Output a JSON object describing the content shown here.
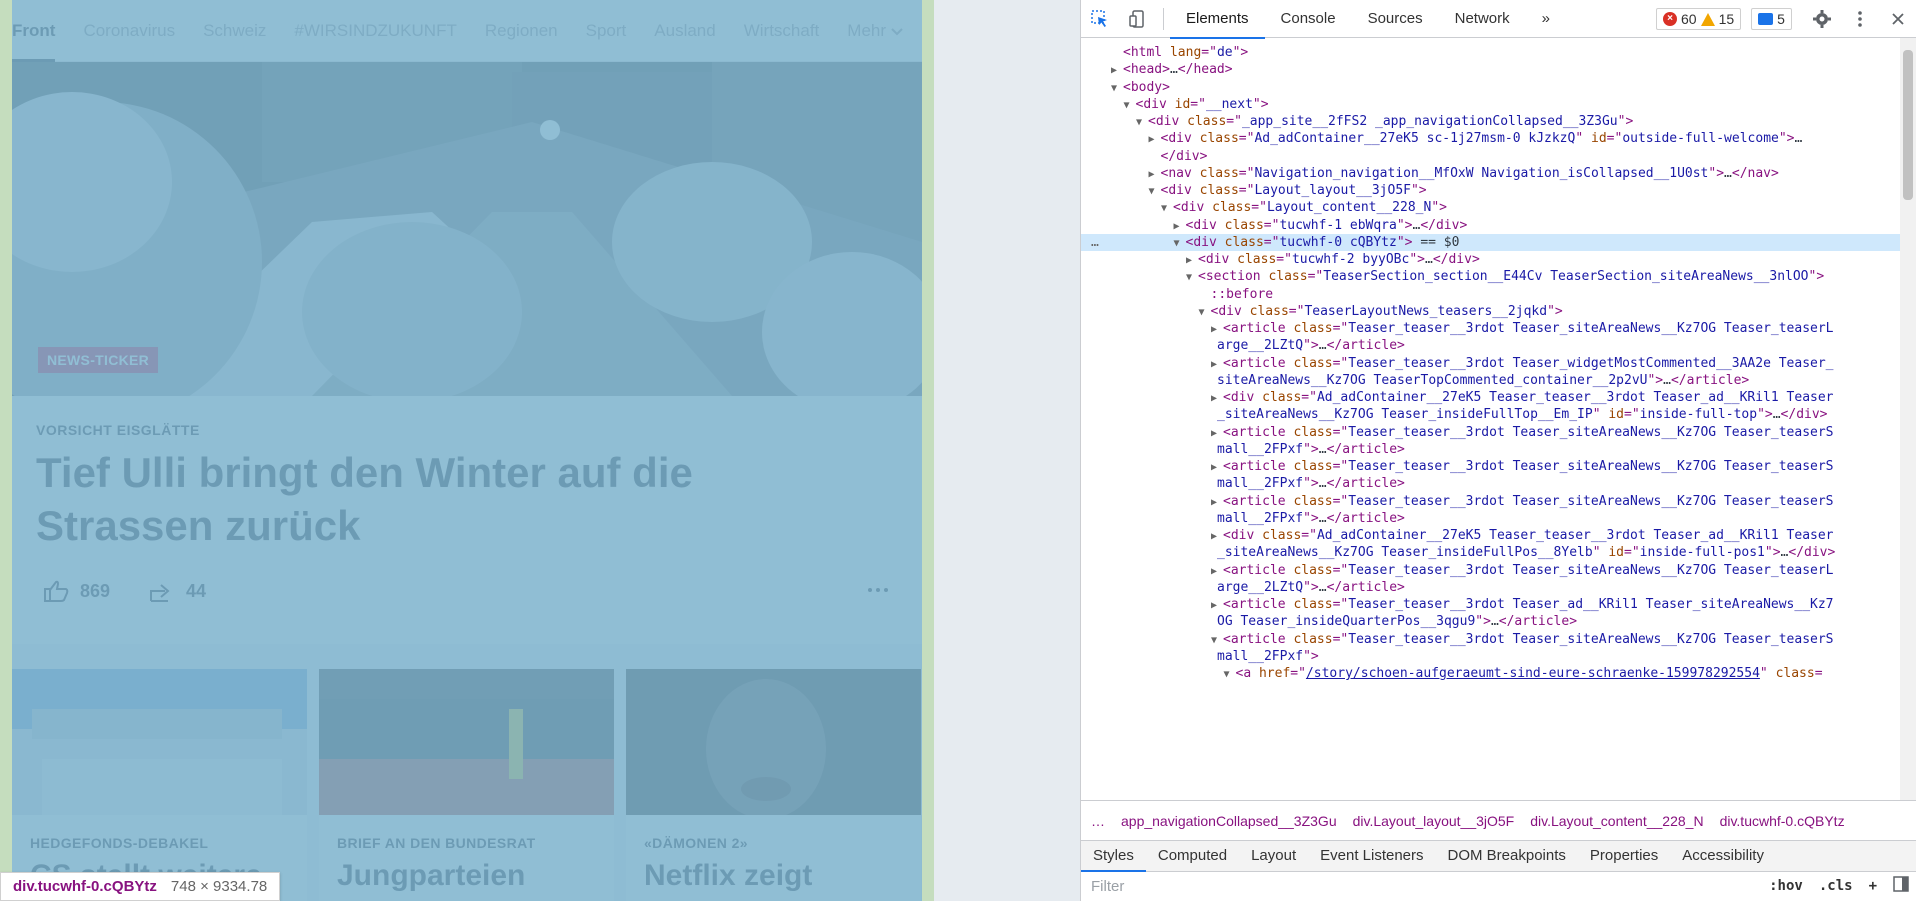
{
  "site": {
    "nav": [
      "Front",
      "Coronavirus",
      "Schweiz",
      "#WIRSINDZUKUNFT",
      "Regionen",
      "Sport",
      "Ausland",
      "Wirtschaft"
    ],
    "nav_more": "Mehr",
    "hero_tag": "NEWS-TICKER",
    "kicker": "VORSICHT EISGLÄTTE",
    "headline": "Tief Ulli bringt den Winter auf die Strassen zurück",
    "likes": "869",
    "shares": "44",
    "teasers": [
      {
        "kicker": "HEDGEFONDS-DEBAKEL",
        "title": "CS stellt weitere"
      },
      {
        "kicker": "BRIEF AN DEN BUNDESRAT",
        "title": "Jungparteien"
      },
      {
        "kicker": "«DÄMONEN 2»",
        "title": "Netflix zeigt"
      }
    ]
  },
  "tooltip": {
    "selector": "div.tucwhf-0.cQBYtz",
    "dims": "748 × 9334.78"
  },
  "devtools": {
    "tabs": [
      "Elements",
      "Console",
      "Sources",
      "Network"
    ],
    "errors": "60",
    "warnings": "15",
    "messages": "5",
    "dom_lines": [
      {
        "indent": 0,
        "arrow": "",
        "html": "<span class='tag'>&lt;html </span><span class='attr'>lang</span><span class='tag'>=\"</span><span class='val'>de</span><span class='tag'>\"&gt;</span>"
      },
      {
        "indent": 0,
        "arrow": "▶",
        "html": "<span class='tag'>&lt;head&gt;</span><span class='txt'>…</span><span class='tag'>&lt;/head&gt;</span>"
      },
      {
        "indent": 0,
        "arrow": "▼",
        "html": "<span class='tag'>&lt;body&gt;</span>"
      },
      {
        "indent": 1,
        "arrow": "▼",
        "html": "<span class='tag'>&lt;div </span><span class='attr'>id</span><span class='tag'>=\"</span><span class='val'>__next</span><span class='tag'>\"&gt;</span>"
      },
      {
        "indent": 2,
        "arrow": "▼",
        "html": "<span class='tag'>&lt;div </span><span class='attr'>class</span><span class='tag'>=\"</span><span class='val'>_app_site__2fFS2 _app_navigationCollapsed__3Z3Gu</span><span class='tag'>\"&gt;</span>"
      },
      {
        "indent": 3,
        "arrow": "▶",
        "html": "<span class='tag'>&lt;div </span><span class='attr'>class</span><span class='tag'>=\"</span><span class='val'>Ad_adContainer__27eK5 sc-1j27msm-0 kJzkzQ</span><span class='tag'>\" </span><span class='attr'>id</span><span class='tag'>=\"</span><span class='val'>outside-full-welcome</span><span class='tag'>\"&gt;</span><span class='txt'>…</span>"
      },
      {
        "indent": 3,
        "arrow": "",
        "html": "<span class='tag'>&lt;/div&gt;</span>"
      },
      {
        "indent": 3,
        "arrow": "▶",
        "html": "<span class='tag'>&lt;nav </span><span class='attr'>class</span><span class='tag'>=\"</span><span class='val'>Navigation_navigation__MfOxW Navigation_isCollapsed__1U0st</span><span class='tag'>\"&gt;</span><span class='txt'>…</span><span class='tag'>&lt;/nav&gt;</span>"
      },
      {
        "indent": 3,
        "arrow": "▼",
        "html": "<span class='tag'>&lt;div </span><span class='attr'>class</span><span class='tag'>=\"</span><span class='val'>Layout_layout__3jO5F</span><span class='tag'>\"&gt;</span>"
      },
      {
        "indent": 4,
        "arrow": "▼",
        "html": "<span class='tag'>&lt;div </span><span class='attr'>class</span><span class='tag'>=\"</span><span class='val'>Layout_content__228_N</span><span class='tag'>\"&gt;</span>"
      },
      {
        "indent": 5,
        "arrow": "▶",
        "html": "<span class='tag'>&lt;div </span><span class='attr'>class</span><span class='tag'>=\"</span><span class='val'>tucwhf-1 ebWqra</span><span class='tag'>\"&gt;</span><span class='txt'>…</span><span class='tag'>&lt;/div&gt;</span>"
      },
      {
        "indent": 5,
        "arrow": "▼",
        "selected": true,
        "html": "<span class='tag'>&lt;div </span><span class='attr'>class</span><span class='tag'>=\"</span><span class='val'>tucwhf-0 cQBYtz</span><span class='tag'>\"&gt;</span><span class='txt'> == $0</span>"
      },
      {
        "indent": 6,
        "arrow": "▶",
        "html": "<span class='tag'>&lt;div </span><span class='attr'>class</span><span class='tag'>=\"</span><span class='val'>tucwhf-2 byyOBc</span><span class='tag'>\"&gt;</span><span class='txt'>…</span><span class='tag'>&lt;/div&gt;</span>"
      },
      {
        "indent": 6,
        "arrow": "▼",
        "html": "<span class='tag'>&lt;section </span><span class='attr'>class</span><span class='tag'>=\"</span><span class='val'>TeaserSection_section__E44Cv TeaserSection_siteAreaNews__3nlOO</span><span class='tag'>\"&gt;</span>"
      },
      {
        "indent": 7,
        "arrow": "",
        "html": "<span class='pseudo'>::before</span>"
      },
      {
        "indent": 7,
        "arrow": "▼",
        "html": "<span class='tag'>&lt;div </span><span class='attr'>class</span><span class='tag'>=\"</span><span class='val'>TeaserLayoutNews_teasers__2jqkd</span><span class='tag'>\"&gt;</span>"
      },
      {
        "indent": 8,
        "arrow": "▶",
        "html": "<span class='tag'>&lt;article </span><span class='attr'>class</span><span class='tag'>=\"</span><span class='val'>Teaser_teaser__3rdot Teaser_siteAreaNews__Kz7OG Teaser_teaserL</span>"
      },
      {
        "indent": 8,
        "arrow": "",
        "cont": true,
        "html": "<span class='val'>arge__2LZtQ</span><span class='tag'>\"&gt;</span><span class='txt'>…</span><span class='tag'>&lt;/article&gt;</span>"
      },
      {
        "indent": 8,
        "arrow": "▶",
        "html": "<span class='tag'>&lt;article </span><span class='attr'>class</span><span class='tag'>=\"</span><span class='val'>Teaser_teaser__3rdot Teaser_widgetMostCommented__3AA2e Teaser_</span>"
      },
      {
        "indent": 8,
        "arrow": "",
        "cont": true,
        "html": "<span class='val'>siteAreaNews__Kz7OG TeaserTopCommented_container__2p2vU</span><span class='tag'>\"&gt;</span><span class='txt'>…</span><span class='tag'>&lt;/article&gt;</span>"
      },
      {
        "indent": 8,
        "arrow": "▶",
        "html": "<span class='tag'>&lt;div </span><span class='attr'>class</span><span class='tag'>=\"</span><span class='val'>Ad_adContainer__27eK5 Teaser_teaser__3rdot Teaser_ad__KRil1 Teaser</span>"
      },
      {
        "indent": 8,
        "arrow": "",
        "cont": true,
        "html": "<span class='val'>_siteAreaNews__Kz7OG Teaser_insideFullTop__Em_IP</span><span class='tag'>\" </span><span class='attr'>id</span><span class='tag'>=\"</span><span class='val'>inside-full-top</span><span class='tag'>\"&gt;</span><span class='txt'>…</span><span class='tag'>&lt;/div&gt;</span>"
      },
      {
        "indent": 8,
        "arrow": "▶",
        "html": "<span class='tag'>&lt;article </span><span class='attr'>class</span><span class='tag'>=\"</span><span class='val'>Teaser_teaser__3rdot Teaser_siteAreaNews__Kz7OG Teaser_teaserS</span>"
      },
      {
        "indent": 8,
        "arrow": "",
        "cont": true,
        "html": "<span class='val'>mall__2FPxf</span><span class='tag'>\"&gt;</span><span class='txt'>…</span><span class='tag'>&lt;/article&gt;</span>"
      },
      {
        "indent": 8,
        "arrow": "▶",
        "html": "<span class='tag'>&lt;article </span><span class='attr'>class</span><span class='tag'>=\"</span><span class='val'>Teaser_teaser__3rdot Teaser_siteAreaNews__Kz7OG Teaser_teaserS</span>"
      },
      {
        "indent": 8,
        "arrow": "",
        "cont": true,
        "html": "<span class='val'>mall__2FPxf</span><span class='tag'>\"&gt;</span><span class='txt'>…</span><span class='tag'>&lt;/article&gt;</span>"
      },
      {
        "indent": 8,
        "arrow": "▶",
        "html": "<span class='tag'>&lt;article </span><span class='attr'>class</span><span class='tag'>=\"</span><span class='val'>Teaser_teaser__3rdot Teaser_siteAreaNews__Kz7OG Teaser_teaserS</span>"
      },
      {
        "indent": 8,
        "arrow": "",
        "cont": true,
        "html": "<span class='val'>mall__2FPxf</span><span class='tag'>\"&gt;</span><span class='txt'>…</span><span class='tag'>&lt;/article&gt;</span>"
      },
      {
        "indent": 8,
        "arrow": "▶",
        "html": "<span class='tag'>&lt;div </span><span class='attr'>class</span><span class='tag'>=\"</span><span class='val'>Ad_adContainer__27eK5 Teaser_teaser__3rdot Teaser_ad__KRil1 Teaser</span>"
      },
      {
        "indent": 8,
        "arrow": "",
        "cont": true,
        "html": "<span class='val'>_siteAreaNews__Kz7OG Teaser_insideFullPos__8Yelb</span><span class='tag'>\" </span><span class='attr'>id</span><span class='tag'>=\"</span><span class='val'>inside-full-pos1</span><span class='tag'>\"&gt;</span><span class='txt'>…</span><span class='tag'>&lt;/div&gt;</span>"
      },
      {
        "indent": 8,
        "arrow": "▶",
        "html": "<span class='tag'>&lt;article </span><span class='attr'>class</span><span class='tag'>=\"</span><span class='val'>Teaser_teaser__3rdot Teaser_siteAreaNews__Kz7OG Teaser_teaserL</span>"
      },
      {
        "indent": 8,
        "arrow": "",
        "cont": true,
        "html": "<span class='val'>arge__2LZtQ</span><span class='tag'>\"&gt;</span><span class='txt'>…</span><span class='tag'>&lt;/article&gt;</span>"
      },
      {
        "indent": 8,
        "arrow": "▶",
        "html": "<span class='tag'>&lt;article </span><span class='attr'>class</span><span class='tag'>=\"</span><span class='val'>Teaser_teaser__3rdot Teaser_ad__KRil1 Teaser_siteAreaNews__Kz7</span>"
      },
      {
        "indent": 8,
        "arrow": "",
        "cont": true,
        "html": "<span class='val'>OG Teaser_insideQuarterPos__3qgu9</span><span class='tag'>\"&gt;</span><span class='txt'>…</span><span class='tag'>&lt;/article&gt;</span>"
      },
      {
        "indent": 8,
        "arrow": "▼",
        "html": "<span class='tag'>&lt;article </span><span class='attr'>class</span><span class='tag'>=\"</span><span class='val'>Teaser_teaser__3rdot Teaser_siteAreaNews__Kz7OG Teaser_teaserS</span>"
      },
      {
        "indent": 8,
        "arrow": "",
        "cont": true,
        "html": "<span class='val'>mall__2FPxf</span><span class='tag'>\"&gt;</span>"
      },
      {
        "indent": 9,
        "arrow": "▼",
        "html": "<span class='tag'>&lt;a </span><span class='attr'>href</span><span class='tag'>=\"</span><span class='link'>/story/schoen-aufgeraeumt-sind-eure-schraenke-159978292554</span><span class='tag'>\" </span><span class='attr'>class</span><span class='tag'>=</span>"
      }
    ],
    "breadcrumbs": [
      "…",
      "app_navigationCollapsed__3Z3Gu",
      "div.Layout_layout__3jO5F",
      "div.Layout_content__228_N",
      "div.tucwhf-0.cQBYtz"
    ],
    "subtabs": [
      "Styles",
      "Computed",
      "Layout",
      "Event Listeners",
      "DOM Breakpoints",
      "Properties",
      "Accessibility"
    ],
    "filter_placeholder": "Filter",
    "filter_tools": [
      ":hov",
      ".cls",
      "+"
    ]
  }
}
